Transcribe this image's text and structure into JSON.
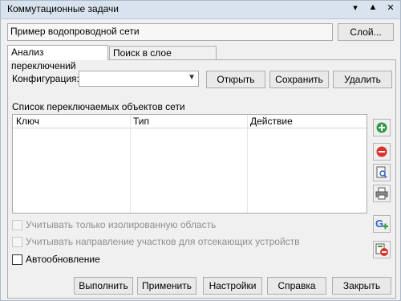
{
  "window": {
    "title": "Коммутационные задачи",
    "controls": [
      "▾",
      "▲",
      "✕"
    ]
  },
  "source": {
    "value": "Пример водопроводной сети",
    "button": "Слой..."
  },
  "tabs": [
    {
      "label": "Анализ переключений",
      "active": true
    },
    {
      "label": "Поиск в слое подложке",
      "active": false
    }
  ],
  "config": {
    "label": "Конфигурация:",
    "value": "",
    "open": "Открыть",
    "save": "Сохранить",
    "delete": "Удалить"
  },
  "list": {
    "title": "Список переключаемых объектов сети",
    "columns": [
      "Ключ",
      "Тип",
      "Действие"
    ]
  },
  "options": [
    {
      "label": "Учитывать только изолированную область",
      "checked": false,
      "enabled": false
    },
    {
      "label": "Учитывать направление участков для отсекающих устройств",
      "checked": false,
      "enabled": false
    },
    {
      "label": "Автообновление",
      "checked": false,
      "enabled": true
    }
  ],
  "footer": {
    "run": "Выполнить",
    "apply": "Применить",
    "settings": "Настройки",
    "help": "Справка",
    "close": "Закрыть"
  },
  "icons": {
    "add": "add-icon",
    "remove": "remove-icon",
    "find": "find-document-icon",
    "print": "print-icon",
    "graph": "graph-add-icon",
    "layer": "layer-remove-icon"
  },
  "colors": {
    "titlebar": "#d9e3ee",
    "add": "#2e9b45",
    "remove": "#d9342b",
    "graph": "#2e62c7"
  }
}
